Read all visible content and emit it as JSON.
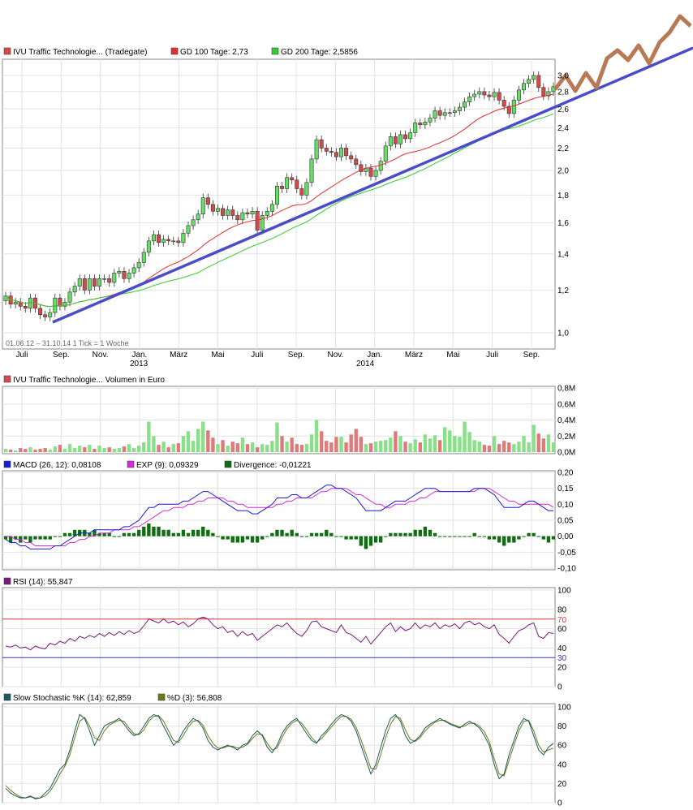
{
  "colors": {
    "up": "#66dd66",
    "down": "#d24a4a",
    "ma100": "#e52d2d",
    "ma200": "#33cc33",
    "trend": "#4a4dc4",
    "projection": "#b87a55",
    "macd": "#1a1ad9",
    "signal": "#d92bd9",
    "divergence": "#0f6e0f",
    "rsi": "#7a1a7a",
    "rsi_upper": "#e33333",
    "rsi_lower": "#3333cc",
    "stoch_k": "#1a5c5c",
    "stoch_d": "#6b7a1a"
  },
  "panels": {
    "price": {
      "legend": [
        {
          "label": "IVU Traffic Technologie... (Tradegate)",
          "color": "#d24a4a"
        },
        {
          "label": "GD 100 Tage: 2,73",
          "color": "#e52d2d"
        },
        {
          "label": "GD 200 Tage: 2,5856",
          "color": "#33cc33"
        }
      ],
      "y_ticks": [
        "3,0",
        "2,8",
        "2,6",
        "2,4",
        "2,2",
        "2,0",
        "1,8",
        "1,6",
        "1,4",
        "1,2",
        "1,0"
      ],
      "range_note": "01.06.12 – 31.10.14    1 Tick = 1 Woche",
      "x_ticks": [
        "Juli",
        "Sep.",
        "Nov.",
        "Jan.",
        "März",
        "Mai",
        "Juli",
        "Sep.",
        "Nov.",
        "Jan.",
        "März",
        "Mai",
        "Juli",
        "Sep."
      ],
      "years": [
        "2013",
        "2014"
      ]
    },
    "volume": {
      "legend": [
        {
          "label": "IVU Traffic Technologie... Volumen in Euro",
          "color": "#d24a4a"
        }
      ],
      "y_ticks": [
        "0,8M",
        "0,6M",
        "0,4M",
        "0,2M",
        "0,0M"
      ]
    },
    "macd": {
      "legend": [
        {
          "label": "MACD (26, 12): 0,08108",
          "color": "#1a1ad9"
        },
        {
          "label": "EXP (9): 0,09329",
          "color": "#d92bd9"
        },
        {
          "label": "Divergence: -0,01221",
          "color": "#0f6e0f"
        }
      ],
      "y_ticks": [
        "0,20",
        "0,15",
        "0,10",
        "0,05",
        "0,00",
        "-0,05",
        "-0,10"
      ]
    },
    "rsi": {
      "legend": [
        {
          "label": "RSI (14): 55,847",
          "color": "#7a1a7a"
        }
      ],
      "y_ticks": [
        "100",
        "80",
        "60",
        "40",
        "20",
        "0"
      ],
      "upper_label": "70",
      "lower_label": "30"
    },
    "stoch": {
      "legend": [
        {
          "label": "Slow Stochastic %K (14): 62,859",
          "color": "#1a5c5c"
        },
        {
          "label": "%D (3): 56,808",
          "color": "#6b7a1a"
        }
      ],
      "y_ticks": [
        "100",
        "80",
        "60",
        "40",
        "20",
        "0"
      ]
    }
  },
  "chart_data": [
    {
      "type": "candlestick",
      "title": "IVU Traffic Technologie... (Tradegate)",
      "period": "01.06.12 – 31.10.14",
      "interval": "1 Tick = 1 Woche",
      "y_scale": "log",
      "ylim": [
        1.0,
        3.1
      ],
      "close": [
        1.17,
        1.13,
        1.14,
        1.12,
        1.11,
        1.16,
        1.11,
        1.08,
        1.07,
        1.09,
        1.16,
        1.12,
        1.14,
        1.19,
        1.22,
        1.26,
        1.2,
        1.26,
        1.22,
        1.26,
        1.26,
        1.24,
        1.29,
        1.3,
        1.26,
        1.29,
        1.32,
        1.35,
        1.41,
        1.48,
        1.52,
        1.47,
        1.49,
        1.48,
        1.48,
        1.47,
        1.53,
        1.58,
        1.62,
        1.66,
        1.78,
        1.73,
        1.68,
        1.7,
        1.65,
        1.69,
        1.65,
        1.62,
        1.67,
        1.66,
        1.68,
        1.55,
        1.65,
        1.68,
        1.73,
        1.87,
        1.85,
        1.94,
        1.92,
        1.85,
        1.8,
        1.9,
        2.1,
        2.28,
        2.2,
        2.17,
        2.16,
        2.12,
        2.2,
        2.13,
        2.1,
        2.05,
        1.99,
        2.02,
        1.95,
        2.0,
        2.08,
        2.22,
        2.31,
        2.24,
        2.33,
        2.29,
        2.35,
        2.45,
        2.43,
        2.46,
        2.5,
        2.58,
        2.53,
        2.56,
        2.56,
        2.58,
        2.62,
        2.68,
        2.74,
        2.77,
        2.8,
        2.76,
        2.74,
        2.79,
        2.7,
        2.63,
        2.55,
        2.7,
        2.82,
        2.9,
        2.95,
        3.0,
        2.85,
        2.75,
        2.8,
        2.86
      ],
      "ma100_last": 2.73,
      "ma200_last": 2.5856
    },
    {
      "type": "bar",
      "title": "IVU Traffic Technologie... Volumen in Euro",
      "ylim": [
        0,
        0.8
      ],
      "unit": "M",
      "values": [
        0.04,
        0.03,
        0.02,
        0.05,
        0.04,
        0.06,
        0.03,
        0.04,
        0.05,
        0.03,
        0.07,
        0.09,
        0.04,
        0.1,
        0.05,
        0.08,
        0.06,
        0.09,
        0.04,
        0.08,
        0.05,
        0.06,
        0.04,
        0.05,
        0.07,
        0.1,
        0.05,
        0.08,
        0.12,
        0.38,
        0.2,
        0.09,
        0.13,
        0.06,
        0.1,
        0.11,
        0.2,
        0.26,
        0.14,
        0.29,
        0.38,
        0.27,
        0.18,
        0.1,
        0.15,
        0.08,
        0.13,
        0.11,
        0.18,
        0.1,
        0.12,
        0.06,
        0.1,
        0.09,
        0.14,
        0.37,
        0.2,
        0.13,
        0.18,
        0.1,
        0.09,
        0.1,
        0.22,
        0.4,
        0.26,
        0.14,
        0.12,
        0.19,
        0.19,
        0.12,
        0.22,
        0.29,
        0.19,
        0.1,
        0.11,
        0.13,
        0.14,
        0.15,
        0.18,
        0.26,
        0.2,
        0.13,
        0.11,
        0.16,
        0.12,
        0.22,
        0.17,
        0.21,
        0.15,
        0.31,
        0.27,
        0.2,
        0.19,
        0.38,
        0.25,
        0.15,
        0.13,
        0.09,
        0.08,
        0.2,
        0.1,
        0.14,
        0.12,
        0.1,
        0.13,
        0.2,
        0.12,
        0.34,
        0.23,
        0.17,
        0.22,
        0.12
      ]
    },
    {
      "type": "line",
      "title": "MACD (26, 12): 0,08108 / EXP (9): 0,09329 / Divergence: -0,01221",
      "ylim": [
        -0.1,
        0.2
      ],
      "series": [
        {
          "name": "MACD (26, 12)",
          "values": [
            -0.01,
            -0.02,
            -0.02,
            -0.03,
            -0.03,
            -0.04,
            -0.04,
            -0.04,
            -0.04,
            -0.04,
            -0.03,
            -0.03,
            -0.02,
            -0.01,
            0.0,
            0.01,
            0.01,
            0.01,
            0.02,
            0.02,
            0.02,
            0.02,
            0.02,
            0.02,
            0.03,
            0.03,
            0.04,
            0.05,
            0.07,
            0.09,
            0.09,
            0.1,
            0.1,
            0.1,
            0.1,
            0.1,
            0.11,
            0.11,
            0.12,
            0.13,
            0.14,
            0.14,
            0.13,
            0.12,
            0.11,
            0.1,
            0.09,
            0.08,
            0.08,
            0.08,
            0.07,
            0.07,
            0.08,
            0.09,
            0.1,
            0.12,
            0.12,
            0.12,
            0.13,
            0.13,
            0.12,
            0.12,
            0.13,
            0.14,
            0.15,
            0.16,
            0.16,
            0.15,
            0.15,
            0.14,
            0.13,
            0.12,
            0.1,
            0.08,
            0.08,
            0.08,
            0.08,
            0.09,
            0.1,
            0.11,
            0.11,
            0.11,
            0.12,
            0.13,
            0.14,
            0.15,
            0.15,
            0.15,
            0.14,
            0.14,
            0.14,
            0.14,
            0.14,
            0.14,
            0.14,
            0.15,
            0.15,
            0.15,
            0.14,
            0.13,
            0.11,
            0.09,
            0.09,
            0.09,
            0.09,
            0.1,
            0.11,
            0.11,
            0.1,
            0.09,
            0.08,
            0.08
          ]
        },
        {
          "name": "EXP (9)",
          "values": [
            0.0,
            0.0,
            -0.01,
            -0.01,
            -0.02,
            -0.02,
            -0.03,
            -0.03,
            -0.03,
            -0.03,
            -0.03,
            -0.03,
            -0.03,
            -0.02,
            -0.02,
            -0.01,
            -0.01,
            0.0,
            0.0,
            0.01,
            0.01,
            0.01,
            0.02,
            0.02,
            0.02,
            0.02,
            0.03,
            0.03,
            0.04,
            0.05,
            0.06,
            0.07,
            0.08,
            0.08,
            0.09,
            0.09,
            0.09,
            0.1,
            0.1,
            0.11,
            0.11,
            0.12,
            0.12,
            0.12,
            0.12,
            0.11,
            0.11,
            0.1,
            0.1,
            0.09,
            0.09,
            0.09,
            0.09,
            0.09,
            0.09,
            0.1,
            0.1,
            0.11,
            0.11,
            0.12,
            0.12,
            0.12,
            0.12,
            0.13,
            0.14,
            0.14,
            0.15,
            0.15,
            0.15,
            0.15,
            0.14,
            0.13,
            0.13,
            0.12,
            0.11,
            0.1,
            0.1,
            0.09,
            0.09,
            0.1,
            0.1,
            0.1,
            0.11,
            0.11,
            0.12,
            0.12,
            0.13,
            0.14,
            0.14,
            0.14,
            0.14,
            0.14,
            0.14,
            0.14,
            0.14,
            0.14,
            0.15,
            0.15,
            0.15,
            0.14,
            0.13,
            0.12,
            0.11,
            0.11,
            0.1,
            0.1,
            0.1,
            0.1,
            0.1,
            0.1,
            0.1,
            0.09
          ]
        },
        {
          "name": "Divergence",
          "values": [
            -0.01,
            -0.02,
            -0.01,
            -0.02,
            -0.01,
            -0.02,
            -0.01,
            -0.01,
            -0.01,
            -0.01,
            0.0,
            0.0,
            0.01,
            0.01,
            0.02,
            0.02,
            0.02,
            0.01,
            0.02,
            0.01,
            0.01,
            0.01,
            0.0,
            0.0,
            0.01,
            0.01,
            0.01,
            0.02,
            0.03,
            0.04,
            0.03,
            0.03,
            0.02,
            0.02,
            0.01,
            0.01,
            0.02,
            0.01,
            0.02,
            0.02,
            0.03,
            0.02,
            0.01,
            0.0,
            -0.01,
            -0.01,
            -0.02,
            -0.02,
            -0.02,
            -0.01,
            -0.02,
            -0.02,
            -0.01,
            0.0,
            0.01,
            0.02,
            0.02,
            0.01,
            0.02,
            0.01,
            0.0,
            0.0,
            0.01,
            0.01,
            0.01,
            0.02,
            0.01,
            0.0,
            0.0,
            -0.01,
            -0.01,
            -0.01,
            -0.03,
            -0.04,
            -0.03,
            -0.02,
            -0.02,
            0.0,
            0.01,
            0.01,
            0.01,
            0.01,
            0.01,
            0.02,
            0.02,
            0.03,
            0.02,
            0.01,
            0.0,
            0.0,
            0.0,
            0.0,
            0.0,
            0.0,
            0.0,
            0.01,
            0.0,
            0.0,
            -0.01,
            -0.01,
            -0.02,
            -0.03,
            -0.02,
            -0.02,
            -0.01,
            0.0,
            0.01,
            0.01,
            0.0,
            -0.01,
            -0.02,
            -0.01
          ]
        }
      ]
    },
    {
      "type": "line",
      "title": "RSI (14): 55,847",
      "ylim": [
        0,
        100
      ],
      "bands": [
        70,
        30
      ],
      "series": [
        {
          "name": "RSI (14)",
          "values": [
            42,
            41,
            43,
            40,
            41,
            38,
            42,
            40,
            39,
            45,
            43,
            47,
            45,
            50,
            47,
            52,
            50,
            53,
            51,
            55,
            52,
            56,
            53,
            57,
            54,
            58,
            55,
            57,
            63,
            70,
            68,
            66,
            70,
            66,
            68,
            64,
            67,
            62,
            65,
            70,
            72,
            70,
            64,
            60,
            62,
            56,
            58,
            52,
            57,
            53,
            55,
            48,
            52,
            56,
            60,
            64,
            62,
            66,
            60,
            55,
            52,
            58,
            67,
            68,
            62,
            60,
            58,
            56,
            64,
            56,
            54,
            50,
            46,
            52,
            44,
            50,
            56,
            62,
            66,
            57,
            62,
            58,
            60,
            66,
            60,
            64,
            62,
            66,
            60,
            64,
            62,
            65,
            60,
            66,
            68,
            64,
            66,
            62,
            60,
            64,
            54,
            50,
            45,
            52,
            58,
            60,
            64,
            66,
            52,
            50,
            56,
            55
          ]
        }
      ]
    },
    {
      "type": "line",
      "title": "Slow Stochastic %K (14): 62,859 / %D (3): 56,808",
      "ylim": [
        0,
        100
      ],
      "series": [
        {
          "name": "Slow Stochastic %K (14)",
          "values": [
            15,
            10,
            7,
            5,
            5,
            7,
            4,
            5,
            10,
            15,
            25,
            35,
            40,
            55,
            75,
            92,
            88,
            75,
            60,
            70,
            80,
            83,
            85,
            88,
            82,
            75,
            70,
            72,
            80,
            88,
            92,
            90,
            80,
            70,
            60,
            65,
            75,
            82,
            88,
            85,
            78,
            65,
            58,
            55,
            58,
            60,
            58,
            55,
            60,
            62,
            70,
            75,
            70,
            58,
            52,
            60,
            72,
            80,
            85,
            88,
            80,
            72,
            65,
            62,
            70,
            75,
            82,
            88,
            92,
            90,
            85,
            75,
            60,
            45,
            30,
            40,
            58,
            75,
            88,
            92,
            85,
            70,
            62,
            65,
            70,
            78,
            82,
            85,
            88,
            85,
            82,
            80,
            78,
            82,
            85,
            82,
            78,
            70,
            60,
            40,
            25,
            30,
            50,
            65,
            80,
            88,
            85,
            70,
            55,
            50,
            58,
            62
          ]
        },
        {
          "name": "%D (3)",
          "values": [
            18,
            13,
            9,
            6,
            5,
            6,
            5,
            5,
            7,
            12,
            20,
            30,
            38,
            50,
            68,
            85,
            89,
            80,
            68,
            65,
            75,
            81,
            84,
            86,
            85,
            78,
            72,
            71,
            76,
            85,
            90,
            91,
            85,
            75,
            65,
            63,
            70,
            79,
            85,
            86,
            81,
            70,
            62,
            57,
            57,
            59,
            59,
            57,
            58,
            61,
            67,
            72,
            71,
            62,
            55,
            57,
            68,
            77,
            83,
            86,
            83,
            76,
            68,
            63,
            67,
            73,
            79,
            85,
            90,
            90,
            87,
            79,
            66,
            51,
            36,
            35,
            50,
            68,
            82,
            90,
            88,
            76,
            66,
            64,
            68,
            75,
            80,
            84,
            86,
            86,
            83,
            81,
            79,
            80,
            83,
            83,
            80,
            74,
            64,
            46,
            30,
            28,
            44,
            60,
            75,
            85,
            86,
            75,
            60,
            53,
            55,
            57
          ]
        }
      ]
    }
  ]
}
